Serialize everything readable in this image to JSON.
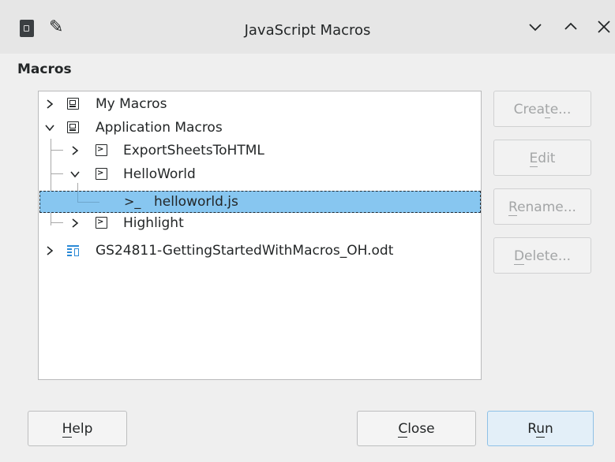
{
  "window": {
    "title": "JavaScript Macros",
    "controls": [
      "minimize",
      "maximize",
      "close"
    ]
  },
  "section_label": "Macros",
  "tree": [
    {
      "label": "My Macros",
      "icon": "computer-icon",
      "expander": "collapsed"
    },
    {
      "label": "Application Macros",
      "icon": "computer-icon",
      "expander": "expanded"
    },
    {
      "label": "ExportSheetsToHTML",
      "icon": "terminal-icon",
      "expander": "collapsed"
    },
    {
      "label": "HelloWorld",
      "icon": "terminal-icon",
      "expander": "expanded"
    },
    {
      "label": "helloworld.js",
      "icon": "script-prompt-icon",
      "selected": true
    },
    {
      "label": "Highlight",
      "icon": "terminal-icon",
      "expander": "collapsed"
    },
    {
      "label": "GS24811-GettingStartedWithMacros_OH.odt",
      "icon": "document-icon",
      "expander": "collapsed"
    }
  ],
  "side_buttons": {
    "create": {
      "pre": "Crea",
      "u": "t",
      "post": "e...",
      "enabled": false
    },
    "edit": {
      "pre": "",
      "u": "E",
      "post": "dit",
      "enabled": false
    },
    "rename": {
      "pre": "",
      "u": "R",
      "post": "ename...",
      "enabled": false
    },
    "delete": {
      "pre": "",
      "u": "D",
      "post": "elete...",
      "enabled": false
    }
  },
  "bottom_buttons": {
    "help": {
      "pre": "",
      "u": "H",
      "post": "elp"
    },
    "close": {
      "pre": "",
      "u": "C",
      "post": "lose"
    },
    "run": {
      "pre": "R",
      "u": "u",
      "post": "n"
    }
  },
  "colors": {
    "selection": "#87c6f0",
    "document_icon": "#2b8ad6",
    "default_button": "#e3eff8"
  }
}
